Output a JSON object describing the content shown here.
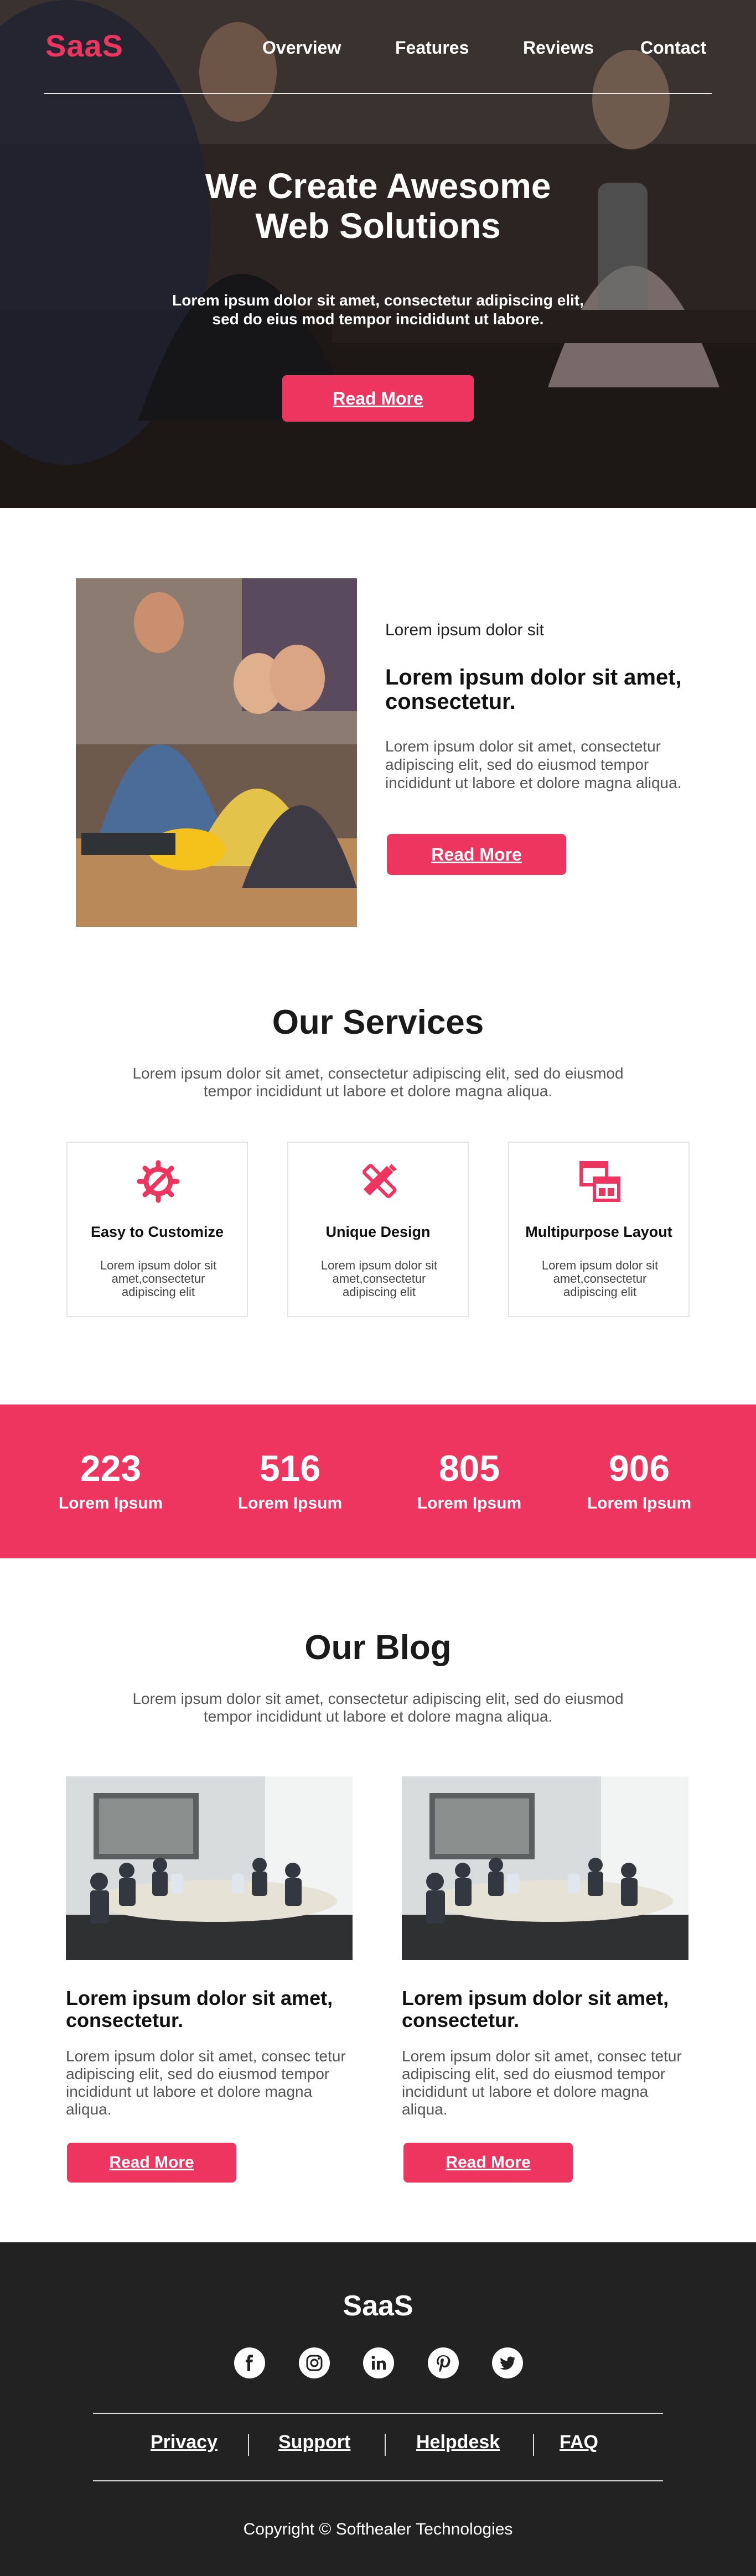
{
  "brand": {
    "logo": "SaaS",
    "accent": "#ee3560",
    "dark": "#222222"
  },
  "nav": {
    "items": [
      "Overview",
      "Features",
      "Reviews",
      "Contact"
    ]
  },
  "hero": {
    "title_line1": "We Create Awesome",
    "title_line2": "Web Solutions",
    "sub_line1": "Lorem ipsum dolor sit amet, consectetur adipiscing elit,",
    "sub_line2": "sed do eius mod tempor incididunt ut labore.",
    "button": "Read More"
  },
  "about": {
    "kicker": "Lorem ipsum dolor sit",
    "title": "Lorem ipsum dolor sit amet, consectetur.",
    "text": "Lorem ipsum dolor sit amet, consectetur adipiscing elit, sed do eiusmod tempor incididunt ut labore et dolore magna aliqua.",
    "button": "Read More"
  },
  "services": {
    "title": "Our Services",
    "sub_line1": "Lorem ipsum dolor sit amet, consectetur adipiscing elit, sed do eiusmod",
    "sub_line2": "tempor incididunt ut labore et dolore magna aliqua.",
    "cards": [
      {
        "icon": "gear-wrench-icon",
        "title": "Easy to Customize",
        "text": "Lorem ipsum dolor sit amet,consectetur adipiscing elit"
      },
      {
        "icon": "pencil-ruler-icon",
        "title": "Unique Design",
        "text": "Lorem ipsum dolor sit amet,consectetur adipiscing elit"
      },
      {
        "icon": "layout-windows-icon",
        "title": "Multipurpose Layout",
        "text": "Lorem ipsum dolor sit amet,consectetur adipiscing elit"
      }
    ]
  },
  "stats": [
    {
      "value": "223",
      "label": "Lorem Ipsum"
    },
    {
      "value": "516",
      "label": "Lorem Ipsum"
    },
    {
      "value": "805",
      "label": "Lorem Ipsum"
    },
    {
      "value": "906",
      "label": "Lorem Ipsum"
    }
  ],
  "blog": {
    "title": "Our Blog",
    "sub_line1": "Lorem ipsum dolor sit amet, consectetur adipiscing elit, sed do eiusmod",
    "sub_line2": "tempor incididunt ut labore et dolore magna aliqua.",
    "posts": [
      {
        "title": "Lorem ipsum dolor sit amet, consectetur.",
        "text": "Lorem ipsum dolor sit amet, consec tetur adipiscing elit, sed do eiusmod tempor incididunt ut labore et dolore magna aliqua.",
        "button": "Read More"
      },
      {
        "title": "Lorem ipsum dolor sit amet, consectetur.",
        "text": "Lorem ipsum dolor sit amet, consec tetur adipiscing elit, sed do eiusmod tempor incididunt ut labore et dolore magna aliqua.",
        "button": "Read More"
      }
    ]
  },
  "footer": {
    "logo": "SaaS",
    "social": [
      "facebook-icon",
      "instagram-icon",
      "linkedin-icon",
      "pinterest-icon",
      "twitter-icon"
    ],
    "links": [
      "Privacy",
      "Support",
      "Helpdesk",
      "FAQ"
    ],
    "copyright": "Copyright © Softhealer Technologies"
  }
}
